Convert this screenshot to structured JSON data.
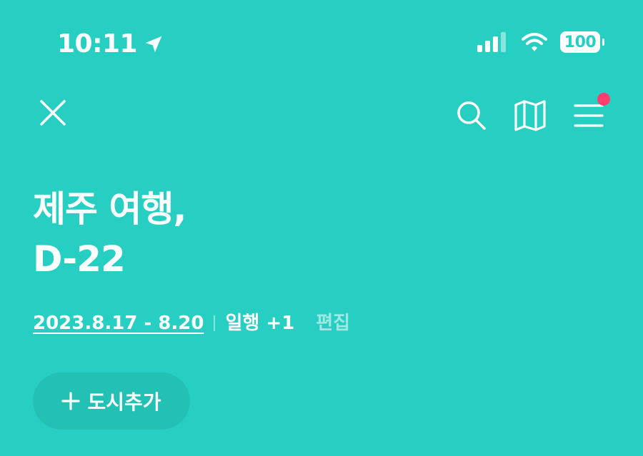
{
  "status_bar": {
    "time": "10:11",
    "battery": "100",
    "icons": [
      "location-arrow-icon",
      "signal-icon",
      "wifi-icon",
      "battery-icon"
    ]
  },
  "nav": {
    "icons": [
      "close-icon",
      "search-icon",
      "map-icon",
      "menu-icon"
    ],
    "notification_color": "#ff3d6e"
  },
  "trip": {
    "title_line1": "제주 여행,",
    "title_line2": "D-22",
    "dates": "2023.8.17 - 8.20",
    "companions": "일행 +1",
    "edit_label": "편집"
  },
  "actions": {
    "add_city_label": "도시추가"
  },
  "colors": {
    "background": "#26cfc2",
    "text": "#ffffff"
  }
}
